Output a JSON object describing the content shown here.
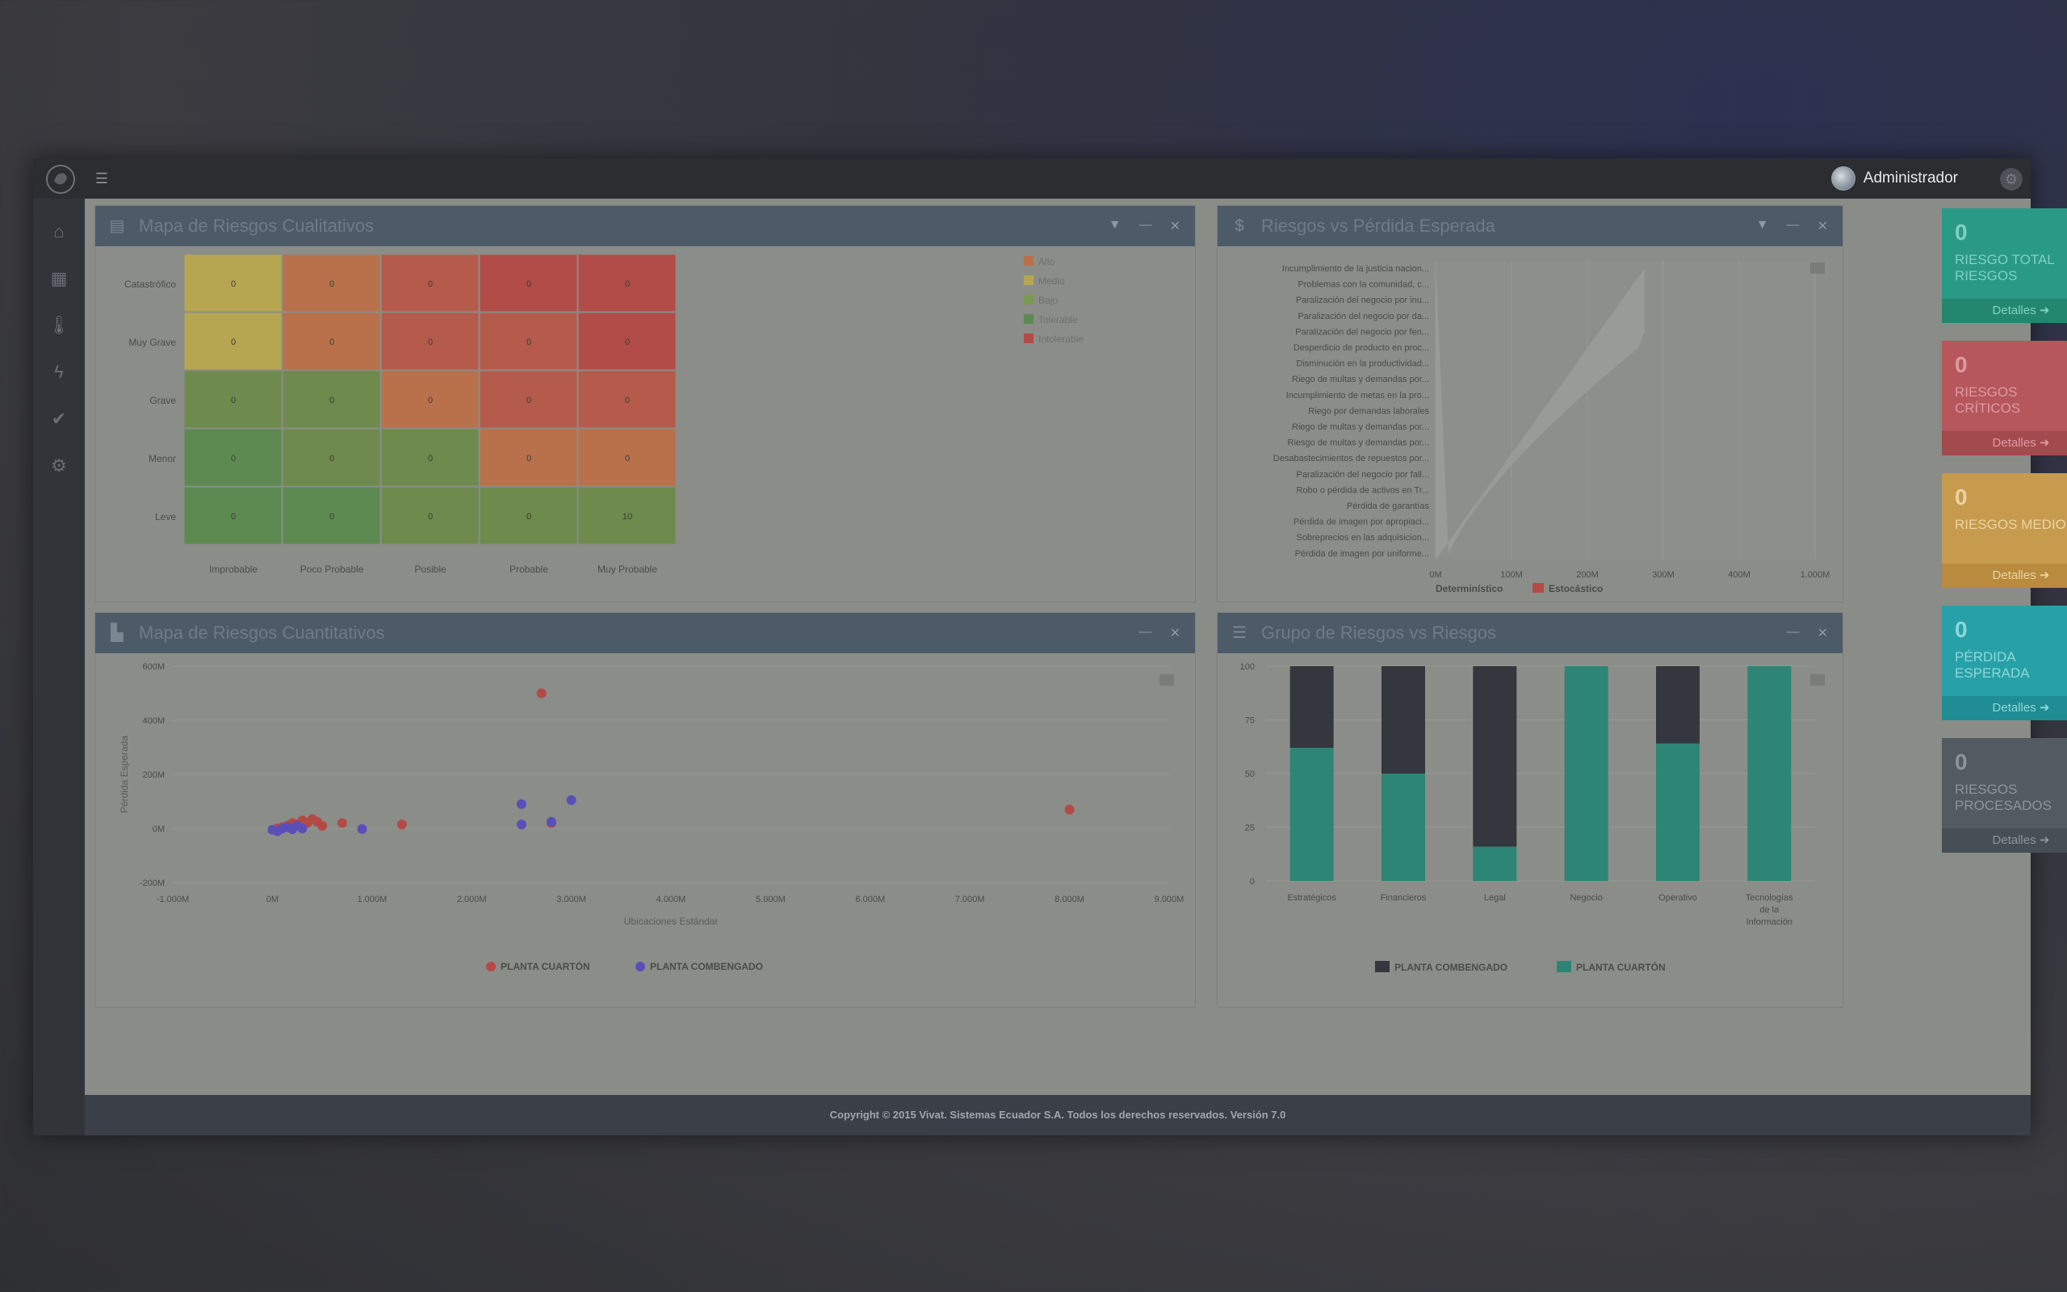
{
  "header": {
    "user_name": "Administrador"
  },
  "sidebar": {
    "items": [
      "home-icon",
      "dashboard-icon",
      "thermometer-icon",
      "bolt-icon",
      "check-icon",
      "gear-icon"
    ]
  },
  "panels": {
    "qualitative": {
      "title": "Mapa de Riesgos Cualitativos"
    },
    "loss": {
      "title": "Riesgos vs Pérdida Esperada"
    },
    "quantitative": {
      "title": "Mapa de Riesgos Cuantitativos"
    },
    "groups": {
      "title": "Grupo de Riesgos vs Riesgos"
    }
  },
  "heatmap": {
    "rows": [
      "Catastrófico",
      "Muy Grave",
      "Grave",
      "Menor",
      "Leve"
    ],
    "cols": [
      "Improbable",
      "Poco Probable",
      "Posible",
      "Probable",
      "Muy Probable"
    ],
    "values": [
      [
        0,
        0,
        0,
        0,
        0
      ],
      [
        0,
        0,
        0,
        0,
        0
      ],
      [
        0,
        0,
        0,
        0,
        0
      ],
      [
        0,
        0,
        0,
        0,
        0
      ],
      [
        0,
        0,
        0,
        0,
        10
      ]
    ],
    "levels": [
      [
        2,
        3,
        4,
        5,
        5
      ],
      [
        2,
        3,
        4,
        4,
        5
      ],
      [
        1,
        1,
        3,
        4,
        4
      ],
      [
        0,
        1,
        1,
        3,
        3
      ],
      [
        0,
        0,
        1,
        1,
        1
      ]
    ],
    "level_colors": [
      "#5d8a50",
      "#6e8a4c",
      "#b7a651",
      "#b8714b",
      "#b45b4b",
      "#b24c48"
    ],
    "legend": [
      {
        "label": "Alto",
        "color": "#b8714b"
      },
      {
        "label": "Medio",
        "color": "#b7a651"
      },
      {
        "label": "Bajo",
        "color": "#7b9a4f"
      },
      {
        "label": "Tolerable",
        "color": "#5d8a50"
      },
      {
        "label": "Intolerable",
        "color": "#b44a46"
      }
    ]
  },
  "loss_chart": {
    "categories": [
      "Incumplimiento de la justicia nacion...",
      "Problemas con la comunidad, c...",
      "Paralización del negocio por inu...",
      "Paralización del negocio por da...",
      "Paralización del negocio por fen...",
      "Desperdicio de producto en proc...",
      "Disminución en la productividad...",
      "Riego de multas y demandas por...",
      "Incumplimiento de metas en la pro...",
      "Riego por demandas laborales",
      "Riego de multas y demandas por...",
      "Riesgo de multas y demandas por...",
      "Desabastecimientos de repuestos por...",
      "Paralización del negocio por fall...",
      "Robo o pérdida de activos en Tr...",
      "Pérdida de garantías",
      "Pérdida de imagen por apropiaci...",
      "Sobreprecios en las adquisicion...",
      "Pérdida de imagen por uniforme..."
    ],
    "x_ticks": [
      "0M",
      "100M",
      "200M",
      "300M",
      "400M",
      "1.000M"
    ],
    "legend": [
      {
        "label": "Determinístico",
        "color": "#8c8e8a"
      },
      {
        "label": "Estocástico",
        "color": "#b44a46"
      }
    ]
  },
  "scatter": {
    "x_label": "Ubicaciones Estándar",
    "y_label": "Pérdida Esperada",
    "x_ticks": [
      "-1.000M",
      "0M",
      "1.000M",
      "2.000M",
      "3.000M",
      "4.000M",
      "5.000M",
      "6.000M",
      "7.000M",
      "8.000M",
      "9.000M"
    ],
    "y_ticks": [
      "-200M",
      "0M",
      "200M",
      "400M",
      "600M"
    ],
    "series": [
      {
        "name": "PLANTA CUARTÓN",
        "color": "#b44a46",
        "points": [
          [
            0.05,
            0
          ],
          [
            0.1,
            5
          ],
          [
            0.15,
            10
          ],
          [
            0.2,
            20
          ],
          [
            0.25,
            15
          ],
          [
            0.3,
            30
          ],
          [
            0.35,
            20
          ],
          [
            0.4,
            35
          ],
          [
            0.45,
            25
          ],
          [
            0.5,
            10
          ],
          [
            0.7,
            20
          ],
          [
            1.3,
            15
          ],
          [
            2.7,
            500
          ],
          [
            2.8,
            20
          ],
          [
            8.0,
            70
          ]
        ]
      },
      {
        "name": "PLANTA COMBENGADO",
        "color": "#5a4fb8",
        "points": [
          [
            0.0,
            -5
          ],
          [
            0.05,
            -10
          ],
          [
            0.1,
            0
          ],
          [
            0.15,
            5
          ],
          [
            0.2,
            -3
          ],
          [
            0.25,
            10
          ],
          [
            0.3,
            0
          ],
          [
            0.9,
            -2
          ],
          [
            2.5,
            90
          ],
          [
            2.5,
            15
          ],
          [
            2.8,
            25
          ],
          [
            3.0,
            105
          ]
        ]
      }
    ]
  },
  "group_chart": {
    "categories": [
      "Estratégicos",
      "Financieros",
      "Legal",
      "Negocio",
      "Operativo",
      "Tecnologías de la Información"
    ],
    "series": [
      {
        "name": "PLANTA COMBENGADO",
        "color": "#34373e",
        "values": [
          38,
          50,
          84,
          0,
          36,
          0
        ]
      },
      {
        "name": "PLANTA CUARTÓN",
        "color": "#2d8575",
        "values": [
          62,
          50,
          16,
          100,
          64,
          100
        ]
      }
    ],
    "y_ticks": [
      "0",
      "25",
      "50",
      "75",
      "100"
    ]
  },
  "cards": [
    {
      "count": "0",
      "label": "RIESGO TOTAL RIESGOS",
      "foot": "Detalles",
      "bg": "#2a9a86",
      "fg": "#7fd0c2",
      "foot_bg": "#23876f"
    },
    {
      "count": "0",
      "label": "RIESGOS CRÍTICOS",
      "foot": "Detalles",
      "bg": "#b5575b",
      "fg": "#dd9aa0",
      "foot_bg": "#a34a4f"
    },
    {
      "count": "0",
      "label": "RIESGOS MEDIOS",
      "foot": "Detalles",
      "bg": "#c69b4e",
      "fg": "#ead3a3",
      "foot_bg": "#b98b3e"
    },
    {
      "count": "0",
      "label": "PÉRDIDA ESPERADA",
      "foot": "Detalles",
      "bg": "#27a1a8",
      "fg": "#8fd6d9",
      "foot_bg": "#1f8d93"
    },
    {
      "count": "0",
      "label": "RIESGOS PROCESADOS",
      "foot": "Detalles",
      "bg": "#535b62",
      "fg": "#8c949a",
      "foot_bg": "#474f56"
    }
  ],
  "footer": {
    "copyright": "Copyright © 2015 Vivat. Sistemas Ecuador S.A. Todos los derechos reservados.",
    "version": "Versión 7.0"
  }
}
